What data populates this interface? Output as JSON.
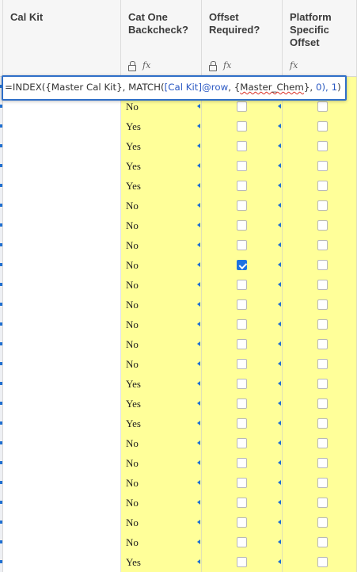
{
  "columns": [
    {
      "title": "Cal Kit",
      "icons": []
    },
    {
      "title": "Cat One\nBackcheck?",
      "icons": [
        "lock-icon",
        "fx-icon"
      ]
    },
    {
      "title": "Offset\nRequired?",
      "icons": [
        "lock-icon",
        "fx-icon"
      ]
    },
    {
      "title": "Platform\nSpecific\nOffset",
      "icons": [
        "fx-icon"
      ]
    }
  ],
  "formula_bar": {
    "text_1": "=INDEX({Master Cal Kit}, MATCH(",
    "text_2": "[Cal Kit]@row",
    "text_3": ", {",
    "text_4": "Master_Chem",
    "text_5": "}, ",
    "text_6": "0",
    "text_7": "), ",
    "text_8": "1",
    "text_9": ")"
  },
  "rows": [
    {
      "backcheck": "",
      "offset_required": false
    },
    {
      "backcheck": "No",
      "offset_required": false
    },
    {
      "backcheck": "Yes",
      "offset_required": false
    },
    {
      "backcheck": "Yes",
      "offset_required": false
    },
    {
      "backcheck": "Yes",
      "offset_required": false
    },
    {
      "backcheck": "Yes",
      "offset_required": false
    },
    {
      "backcheck": "No",
      "offset_required": false
    },
    {
      "backcheck": "No",
      "offset_required": false
    },
    {
      "backcheck": "No",
      "offset_required": false
    },
    {
      "backcheck": "No",
      "offset_required": true
    },
    {
      "backcheck": "No",
      "offset_required": false
    },
    {
      "backcheck": "No",
      "offset_required": false
    },
    {
      "backcheck": "No",
      "offset_required": false
    },
    {
      "backcheck": "No",
      "offset_required": false
    },
    {
      "backcheck": "No",
      "offset_required": false
    },
    {
      "backcheck": "Yes",
      "offset_required": false
    },
    {
      "backcheck": "Yes",
      "offset_required": false
    },
    {
      "backcheck": "Yes",
      "offset_required": false
    },
    {
      "backcheck": "No",
      "offset_required": false
    },
    {
      "backcheck": "No",
      "offset_required": false
    },
    {
      "backcheck": "No",
      "offset_required": false
    },
    {
      "backcheck": "No",
      "offset_required": false
    },
    {
      "backcheck": "No",
      "offset_required": false
    },
    {
      "backcheck": "No",
      "offset_required": false
    },
    {
      "backcheck": "Yes",
      "offset_required": false
    }
  ],
  "colors": {
    "cell_yellow": "#ffff99",
    "accent_blue": "#1e72e0",
    "formula_border": "#2f6fc8"
  }
}
